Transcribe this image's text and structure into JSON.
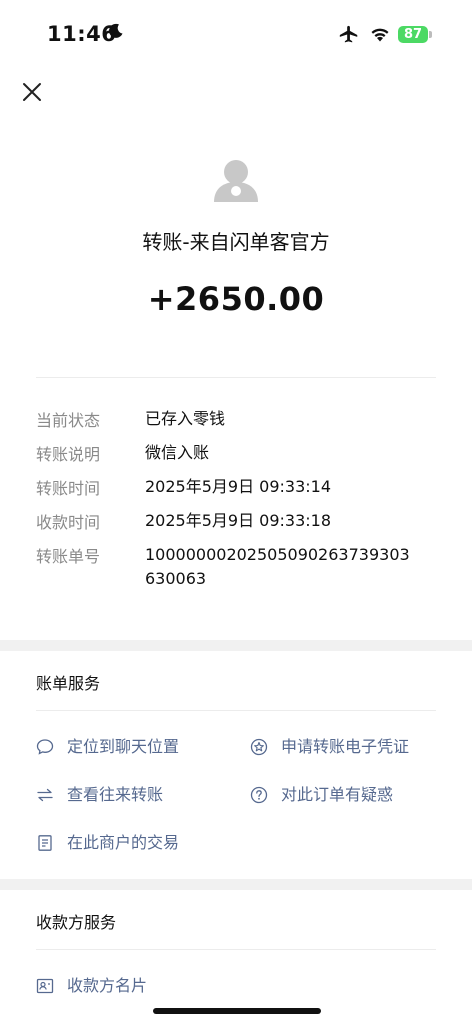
{
  "status_bar": {
    "time": "11:46",
    "battery": "87"
  },
  "header": {
    "title": "转账-来自闪单客官方",
    "amount": "+2650.00"
  },
  "details": [
    {
      "key": "当前状态",
      "value": "已存入零钱"
    },
    {
      "key": "转账说明",
      "value": "微信入账"
    },
    {
      "key": "转账时间",
      "value": "2025年5月9日 09:33:14"
    },
    {
      "key": "收款时间",
      "value": "2025年5月9日 09:33:18"
    },
    {
      "key": "转账单号",
      "value": "10000000202505090263739303630063"
    }
  ],
  "bill_services": {
    "title": "账单服务",
    "items": [
      {
        "label": "定位到聊天位置",
        "icon": "chat-bubble-icon"
      },
      {
        "label": "申请转账电子凭证",
        "icon": "certificate-icon"
      },
      {
        "label": "查看往来转账",
        "icon": "swap-arrows-icon"
      },
      {
        "label": "对此订单有疑惑",
        "icon": "question-icon"
      },
      {
        "label": "在此商户的交易",
        "icon": "document-icon"
      }
    ]
  },
  "payee_services": {
    "title": "收款方服务",
    "items": [
      {
        "label": "收款方名片",
        "icon": "contact-card-icon"
      }
    ]
  },
  "colors": {
    "link": "#56698f",
    "label_gray": "#8a8a8a",
    "battery_green": "#4cd964"
  }
}
